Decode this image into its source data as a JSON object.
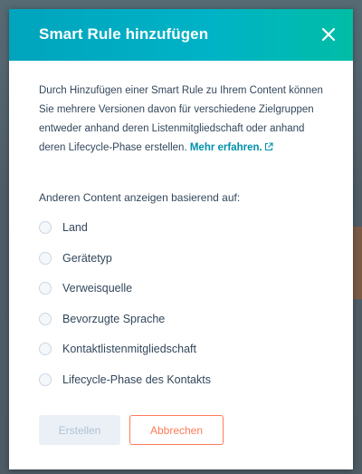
{
  "modal": {
    "title": "Smart Rule hinzufügen",
    "close_icon": "close-icon"
  },
  "intro": {
    "text": "Durch Hinzufügen einer Smart Rule zu Ihrem Content können Sie mehrere Versionen davon für verschiedene Zielgruppen entweder anhand deren Listenmitgliedschaft oder anhand deren Lifecycle-Phase erstellen. ",
    "link_label": "Mehr erfahren.",
    "link_icon": "external-link-icon"
  },
  "section_label": "Anderen Content anzeigen basierend auf:",
  "options": [
    {
      "label": "Land",
      "selected": false
    },
    {
      "label": "Gerätetyp",
      "selected": false
    },
    {
      "label": "Verweisquelle",
      "selected": false
    },
    {
      "label": "Bevorzugte Sprache",
      "selected": false
    },
    {
      "label": "Kontaktlistenmitgliedschaft",
      "selected": false
    },
    {
      "label": "Lifecycle-Phase des Kontakts",
      "selected": false
    }
  ],
  "buttons": {
    "create_label": "Erstellen",
    "create_disabled": true,
    "cancel_label": "Abbrechen"
  },
  "colors": {
    "header_start": "#00a4bd",
    "header_end": "#00bda5",
    "link": "#0091ae",
    "cancel": "#ff7a59",
    "text": "#33475b"
  }
}
